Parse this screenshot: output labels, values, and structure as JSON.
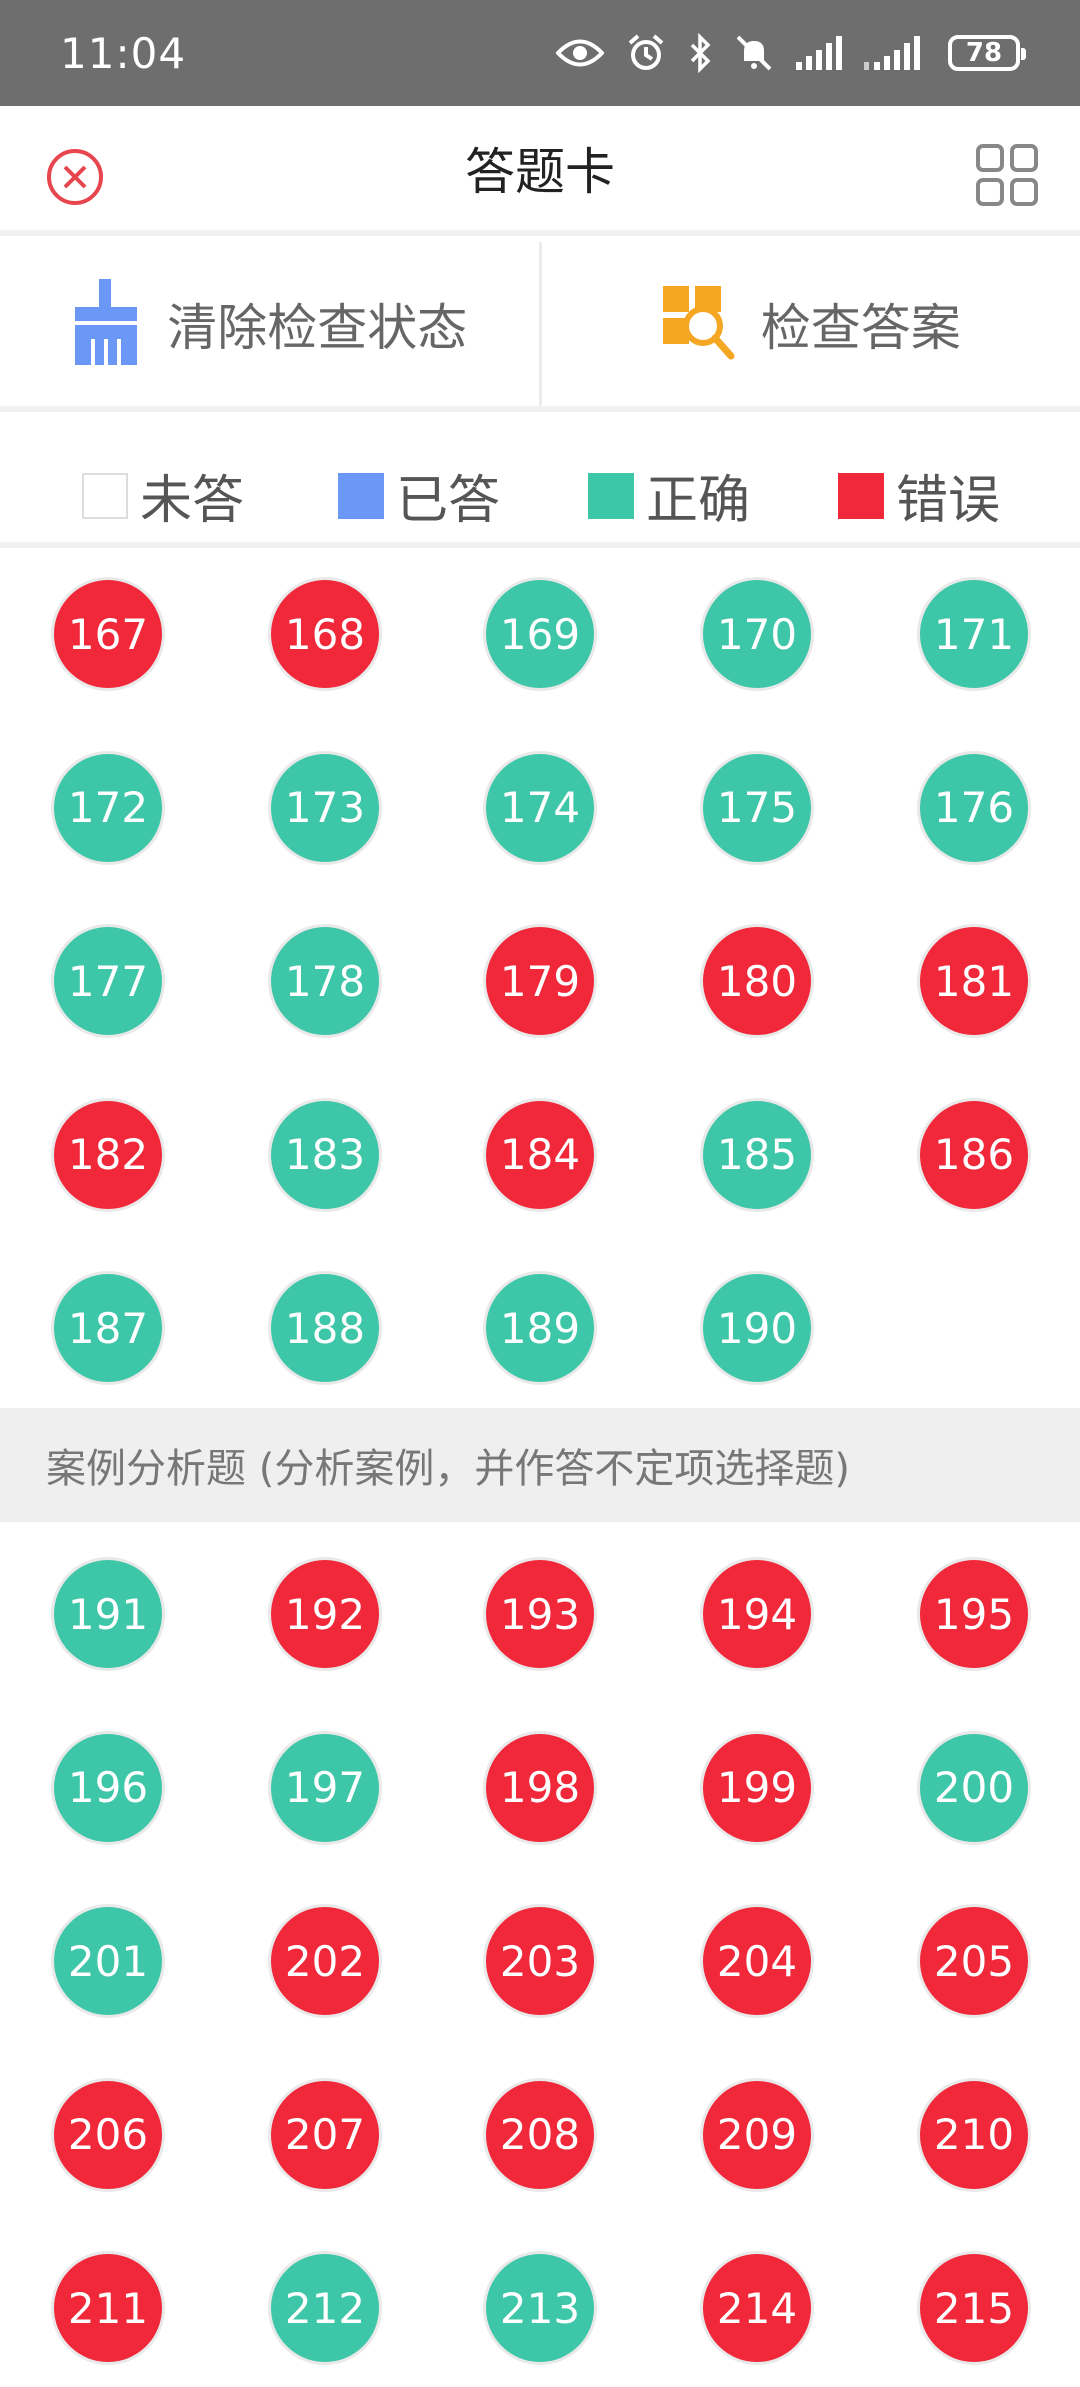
{
  "status_bar": {
    "time": "11:04",
    "battery": "78"
  },
  "header": {
    "title": "答题卡"
  },
  "tools": {
    "clear_label": "清除检查状态",
    "check_label": "检查答案"
  },
  "legend": {
    "unanswered": "未答",
    "answered": "已答",
    "correct": "正确",
    "wrong": "错误"
  },
  "colors": {
    "unanswered": "#ffffff",
    "answered": "#6b97f7",
    "correct": "#3ec6a8",
    "wrong": "#f0283a",
    "clear_icon": "#6b97f7",
    "check_icon": "#f5a623",
    "close_icon": "#e8464e"
  },
  "section_title": "案例分析题 (分析案例，并作答不定项选择题)",
  "group1": [
    [
      {
        "n": "167",
        "s": "wrong"
      },
      {
        "n": "168",
        "s": "wrong"
      },
      {
        "n": "169",
        "s": "correct"
      },
      {
        "n": "170",
        "s": "correct"
      },
      {
        "n": "171",
        "s": "correct"
      }
    ],
    [
      {
        "n": "172",
        "s": "correct"
      },
      {
        "n": "173",
        "s": "correct"
      },
      {
        "n": "174",
        "s": "correct"
      },
      {
        "n": "175",
        "s": "correct"
      },
      {
        "n": "176",
        "s": "correct"
      }
    ],
    [
      {
        "n": "177",
        "s": "correct"
      },
      {
        "n": "178",
        "s": "correct"
      },
      {
        "n": "179",
        "s": "wrong"
      },
      {
        "n": "180",
        "s": "wrong"
      },
      {
        "n": "181",
        "s": "wrong"
      }
    ],
    [
      {
        "n": "182",
        "s": "wrong"
      },
      {
        "n": "183",
        "s": "correct"
      },
      {
        "n": "184",
        "s": "wrong"
      },
      {
        "n": "185",
        "s": "correct"
      },
      {
        "n": "186",
        "s": "wrong"
      }
    ],
    [
      {
        "n": "187",
        "s": "correct"
      },
      {
        "n": "188",
        "s": "correct"
      },
      {
        "n": "189",
        "s": "correct"
      },
      {
        "n": "190",
        "s": "correct"
      }
    ]
  ],
  "group2": [
    [
      {
        "n": "191",
        "s": "correct"
      },
      {
        "n": "192",
        "s": "wrong"
      },
      {
        "n": "193",
        "s": "wrong"
      },
      {
        "n": "194",
        "s": "wrong"
      },
      {
        "n": "195",
        "s": "wrong"
      }
    ],
    [
      {
        "n": "196",
        "s": "correct"
      },
      {
        "n": "197",
        "s": "correct"
      },
      {
        "n": "198",
        "s": "wrong"
      },
      {
        "n": "199",
        "s": "wrong"
      },
      {
        "n": "200",
        "s": "correct"
      }
    ],
    [
      {
        "n": "201",
        "s": "correct"
      },
      {
        "n": "202",
        "s": "wrong"
      },
      {
        "n": "203",
        "s": "wrong"
      },
      {
        "n": "204",
        "s": "wrong"
      },
      {
        "n": "205",
        "s": "wrong"
      }
    ],
    [
      {
        "n": "206",
        "s": "wrong"
      },
      {
        "n": "207",
        "s": "wrong"
      },
      {
        "n": "208",
        "s": "wrong"
      },
      {
        "n": "209",
        "s": "wrong"
      },
      {
        "n": "210",
        "s": "wrong"
      }
    ],
    [
      {
        "n": "211",
        "s": "wrong"
      },
      {
        "n": "212",
        "s": "correct"
      },
      {
        "n": "213",
        "s": "correct"
      },
      {
        "n": "214",
        "s": "wrong"
      },
      {
        "n": "215",
        "s": "wrong"
      }
    ]
  ]
}
